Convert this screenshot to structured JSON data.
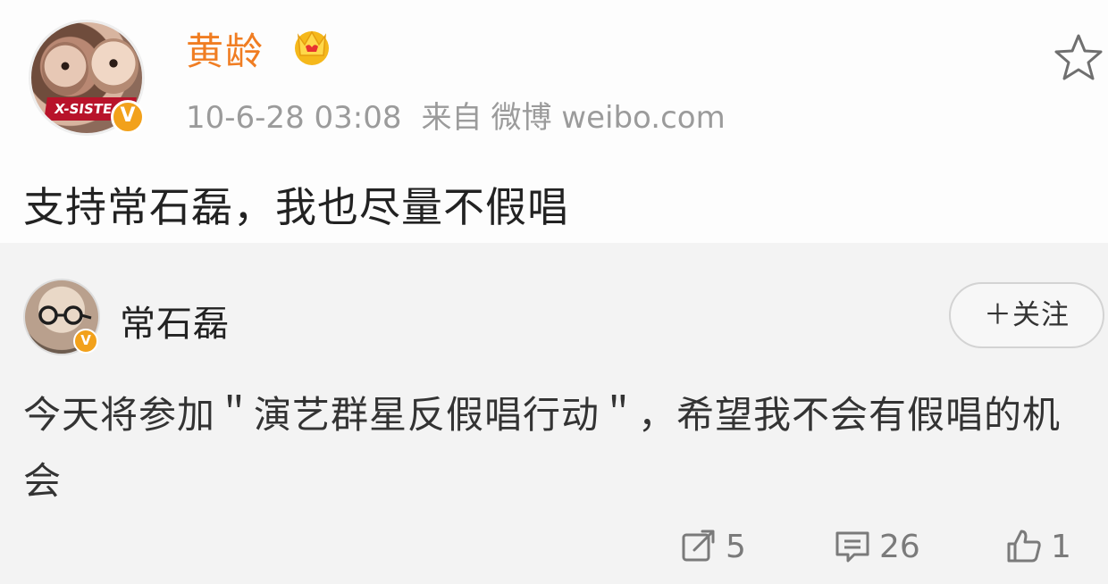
{
  "post": {
    "author_name": "黄龄",
    "avatar_banner_text": "X-SISTE",
    "timestamp": "10-6-28 03:08",
    "source_prefix": "来自",
    "source_name": "微博 weibo.com",
    "text": "支持常石磊，我也尽量不假唱",
    "verified_badge": "V"
  },
  "repost": {
    "author_name": "常石磊",
    "verified_badge": "V",
    "follow_label": "＋关注",
    "text": "今天将参加＂演艺群星反假唱行动＂，希望我不会有假唱的机会",
    "actions": {
      "repost_count": "5",
      "comment_count": "26",
      "like_count": "1"
    }
  },
  "icons": {
    "crown": "vip-crown-icon",
    "star": "favorite-star-icon",
    "repost": "repost-icon",
    "comment": "comment-icon",
    "like": "thumbs-up-icon"
  },
  "colors": {
    "author_name": "#f07d22",
    "verified_badge": "#f2a11b",
    "meta_text": "#9b9b9b",
    "repost_background": "#f3f3f3"
  }
}
